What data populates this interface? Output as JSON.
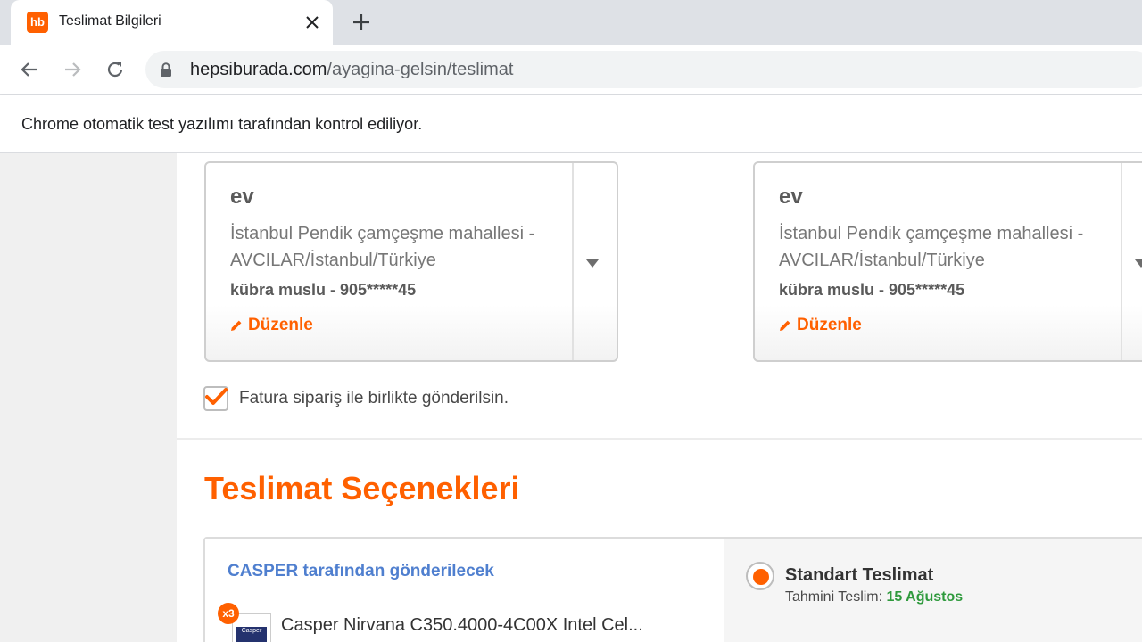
{
  "browser": {
    "tab_title": "Teslimat Bilgileri",
    "favicon_text": "hb",
    "url_host": "hepsiburada.com",
    "url_path": "/ayagina-gelsin/teslimat",
    "infobar_text": "Chrome otomatik test yazılımı tarafından kontrol ediliyor."
  },
  "addresses": [
    {
      "name": "ev",
      "line": "İstanbul Pendik çamçeşme mahallesi - AVCILAR/İstanbul/Türkiye",
      "person": "kübra muslu - 905*****45",
      "edit_label": "Düzenle"
    },
    {
      "name": "ev",
      "line": "İstanbul Pendik çamçeşme mahallesi - AVCILAR/İstanbul/Türkiye",
      "person": "kübra muslu - 905*****45",
      "edit_label": "Düzenle"
    }
  ],
  "invoice": {
    "label": "Fatura sipariş ile birlikte gönderilsin.",
    "checked": true
  },
  "delivery": {
    "section_title": "Teslimat Seçenekleri",
    "seller_label": "CASPER tarafından gönderilecek",
    "product": {
      "quantity_badge": "x3",
      "name": "Casper Nirvana C350.4000-4C00X Intel Cel...",
      "thumb_text": "Casper"
    },
    "option": {
      "title": "Standart Teslimat",
      "estimate_label": "Tahmini Teslim:",
      "estimate_date": "15 Ağustos",
      "selected": true
    }
  },
  "colors": {
    "brand_orange": "#ff6000",
    "seller_blue": "#4f7fcf",
    "date_green": "#2f9a3d"
  }
}
